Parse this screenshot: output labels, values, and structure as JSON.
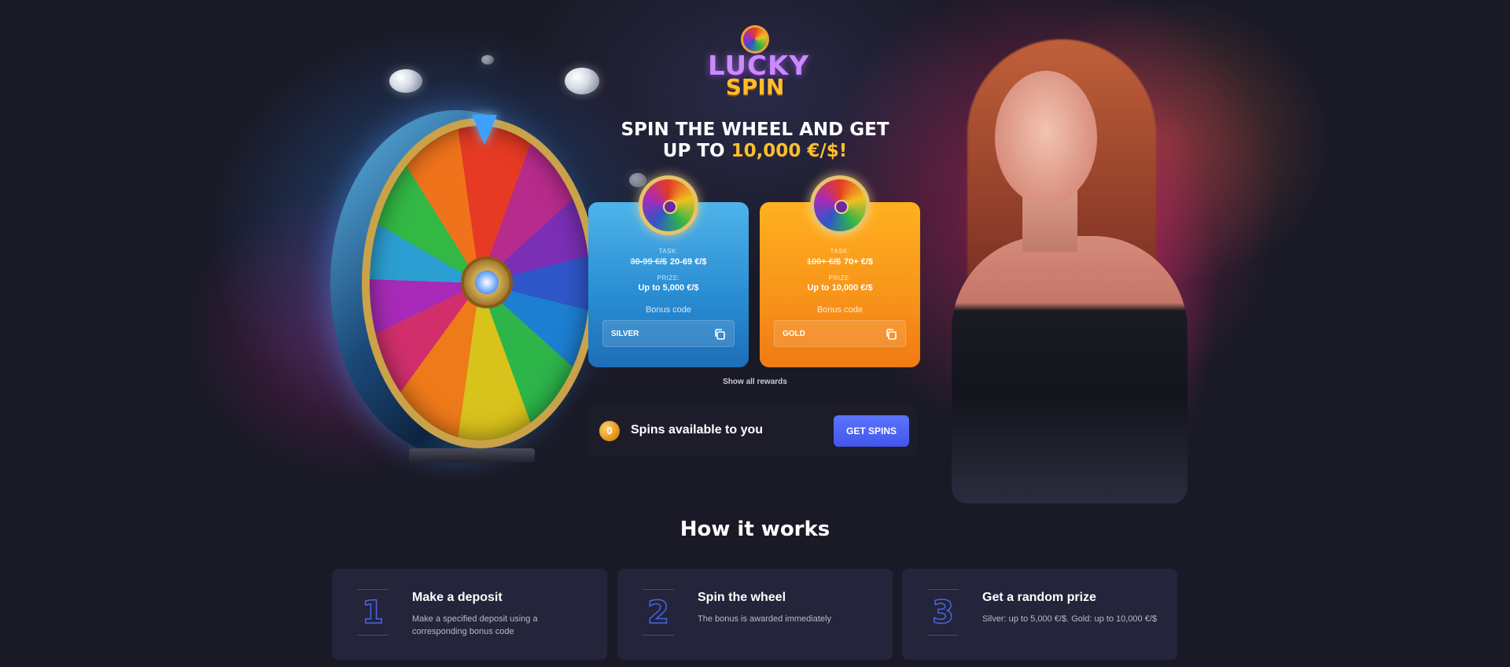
{
  "colors": {
    "background": "#1a1a27",
    "accent": "#ffbe2e",
    "silver_card": "#2a8ed3",
    "gold_card": "#f8951a",
    "button": "#4f65f5"
  },
  "logo": {
    "line1": "LUCKY",
    "line2": "SPIN"
  },
  "headline": {
    "line1": "SPIN THE WHEEL AND GET",
    "line2_prefix": "UP TO ",
    "line2_accent": "10,000 €/$!"
  },
  "cards": [
    {
      "task_label": "TASK:",
      "task_old": "30-99 €/$",
      "task_new": "20-69 €/$",
      "prize_label": "PRIZE:",
      "prize": "Up to 5,000 €/$",
      "bonus_label": "Bonus code",
      "code": "SILVER",
      "icon": "copy-icon"
    },
    {
      "task_label": "TASK:",
      "task_old": "100+ €/$",
      "task_new": "70+ €/$",
      "prize_label": "PRIZE:",
      "prize": "Up to 10,000 €/$",
      "bonus_label": "Bonus code",
      "code": "GOLD",
      "icon": "copy-icon"
    }
  ],
  "show_all": "Show all rewards",
  "spins": {
    "count": "0",
    "label": "Spins available to you",
    "button": "GET SPINS"
  },
  "how_it_works": {
    "title": "How it works",
    "steps": [
      {
        "number": "1",
        "title": "Make a deposit",
        "description": "Make a specified deposit using a corresponding bonus code"
      },
      {
        "number": "2",
        "title": "Spin the wheel",
        "description": "The bonus is awarded immediately"
      },
      {
        "number": "3",
        "title": "Get a random prize",
        "description": "Silver: up to 5,000 €/$. Gold: up to 10,000 €/$"
      }
    ]
  }
}
